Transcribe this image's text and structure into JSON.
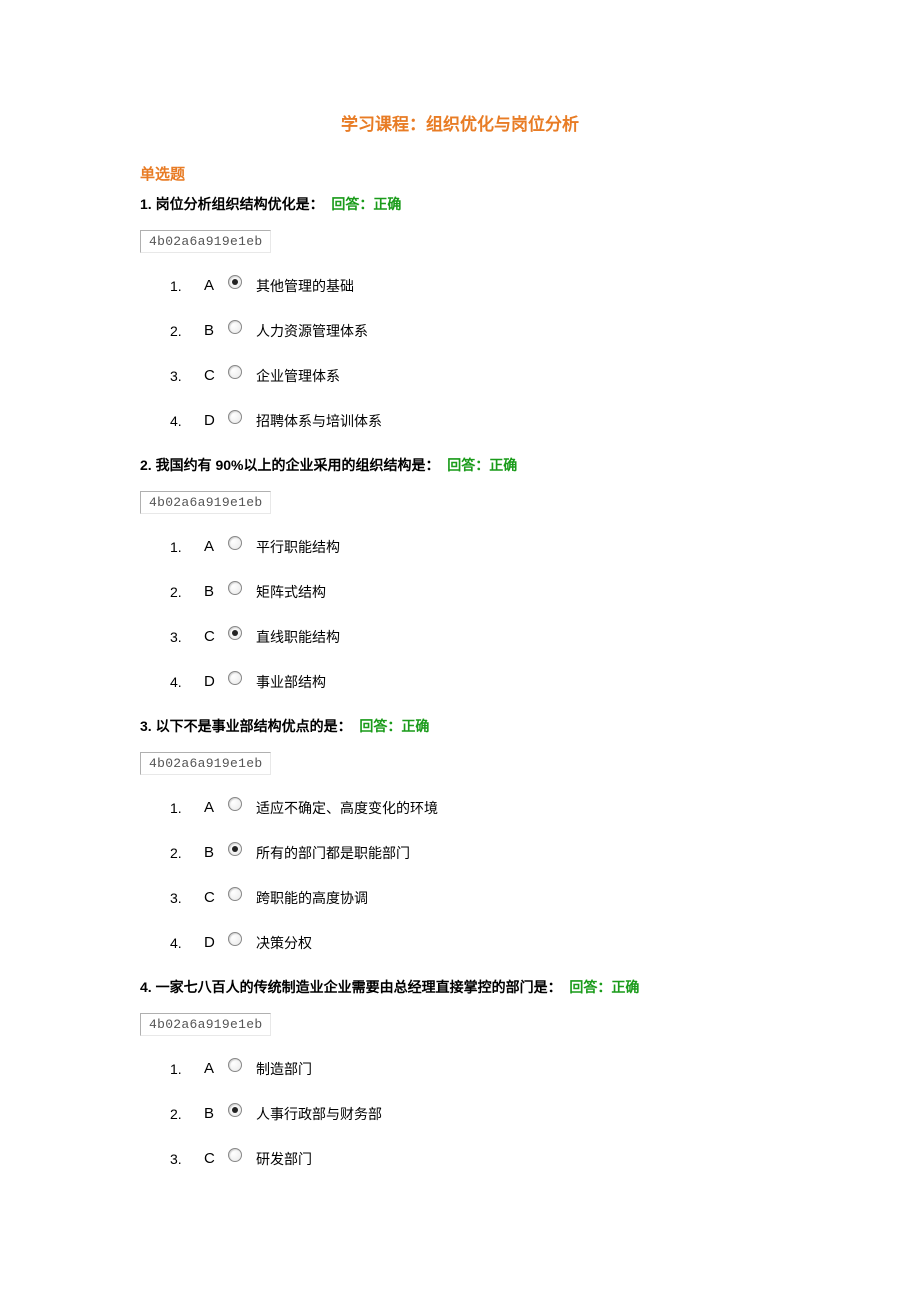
{
  "course_title": "学习课程：组织优化与岗位分析",
  "section_header": "单选题",
  "code_token": "4b02a6a919e1eb",
  "answer_prefix": "回答：",
  "answer_value": "正确",
  "questions": [
    {
      "number": "1.",
      "stem": "岗位分析组织结构优化是：",
      "options": [
        {
          "idx": "1.",
          "letter": "A",
          "text": "其他管理的基础",
          "selected": true
        },
        {
          "idx": "2.",
          "letter": "B",
          "text": "人力资源管理体系",
          "selected": false
        },
        {
          "idx": "3.",
          "letter": "C",
          "text": "企业管理体系",
          "selected": false
        },
        {
          "idx": "4.",
          "letter": "D",
          "text": "招聘体系与培训体系",
          "selected": false
        }
      ]
    },
    {
      "number": "2.",
      "stem": "我国约有 90%以上的企业采用的组织结构是：",
      "options": [
        {
          "idx": "1.",
          "letter": "A",
          "text": "平行职能结构",
          "selected": false
        },
        {
          "idx": "2.",
          "letter": "B",
          "text": "矩阵式结构",
          "selected": false
        },
        {
          "idx": "3.",
          "letter": "C",
          "text": "直线职能结构",
          "selected": true
        },
        {
          "idx": "4.",
          "letter": "D",
          "text": "事业部结构",
          "selected": false
        }
      ]
    },
    {
      "number": "3.",
      "stem": "以下不是事业部结构优点的是：",
      "options": [
        {
          "idx": "1.",
          "letter": "A",
          "text": "适应不确定、高度变化的环境",
          "selected": false
        },
        {
          "idx": "2.",
          "letter": "B",
          "text": "所有的部门都是职能部门",
          "selected": true
        },
        {
          "idx": "3.",
          "letter": "C",
          "text": "跨职能的高度协调",
          "selected": false
        },
        {
          "idx": "4.",
          "letter": "D",
          "text": "决策分权",
          "selected": false
        }
      ]
    },
    {
      "number": "4.",
      "stem": "一家七八百人的传统制造业企业需要由总经理直接掌控的部门是：",
      "options": [
        {
          "idx": "1.",
          "letter": "A",
          "text": "制造部门",
          "selected": false
        },
        {
          "idx": "2.",
          "letter": "B",
          "text": "人事行政部与财务部",
          "selected": true
        },
        {
          "idx": "3.",
          "letter": "C",
          "text": "研发部门",
          "selected": false
        }
      ]
    }
  ]
}
